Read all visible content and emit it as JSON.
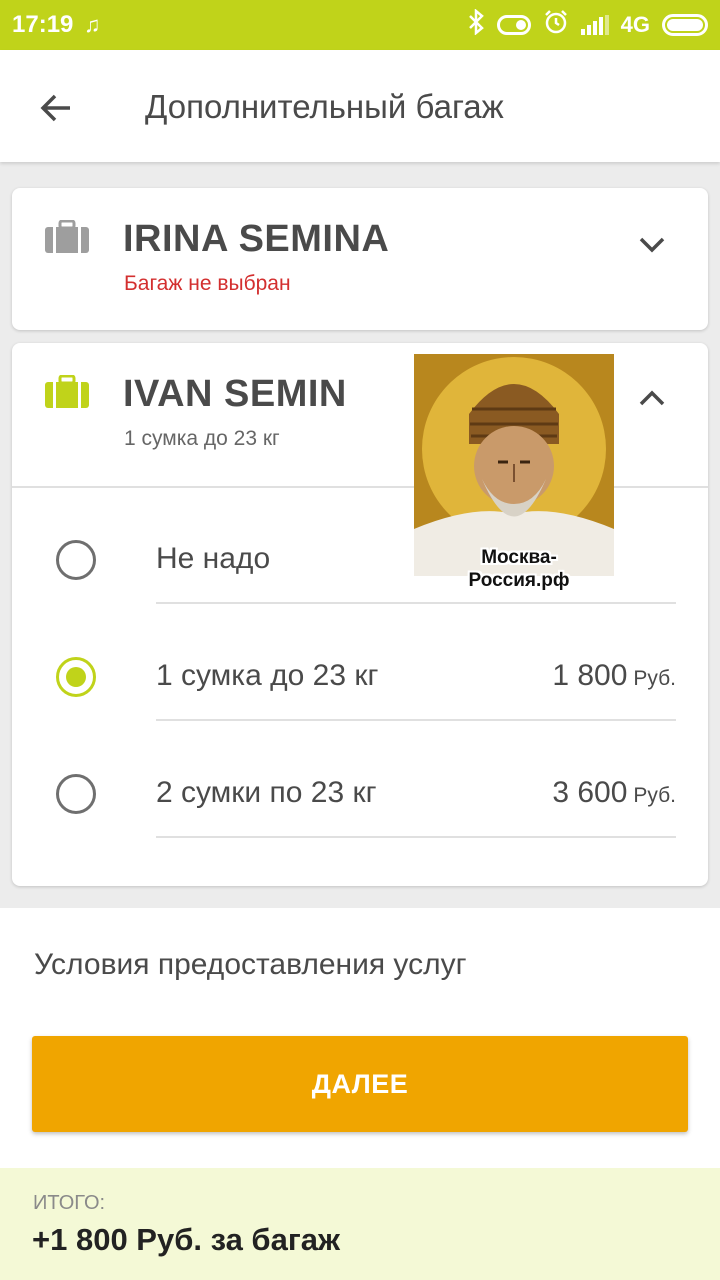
{
  "status_bar": {
    "time": "17:19",
    "network": "4G",
    "icons": [
      "music-app-icon",
      "bluetooth-icon",
      "toggle-icon",
      "alarm-icon",
      "signal-icon",
      "battery-icon"
    ]
  },
  "app_bar": {
    "title": "Дополнительный багаж",
    "back_icon": "arrow-left-icon"
  },
  "passengers": [
    {
      "name": "IRINA SEMINA",
      "status": "Багаж не выбран",
      "status_color": "#d32f2f",
      "bag_icon_color": "#9e9e9e",
      "expanded": false
    },
    {
      "name": "IVAN SEMIN",
      "status": "1 сумка до 23 кг",
      "status_color": "#666666",
      "bag_icon_color": "#c0d31a",
      "expanded": true,
      "options": [
        {
          "label": "Не надо",
          "price": "",
          "currency": "",
          "selected": false
        },
        {
          "label": "1 сумка до 23 кг",
          "price": "1 800",
          "currency": "Руб.",
          "selected": true
        },
        {
          "label": "2 сумки по 23 кг",
          "price": "3 600",
          "currency": "Руб.",
          "selected": false
        }
      ]
    }
  ],
  "overlay": {
    "caption_line1": "Москва-",
    "caption_line2": "Россия.рф"
  },
  "terms_link": "Условия предоставления услуг",
  "next_button": "ДАЛЕЕ",
  "footer": {
    "total_label": "ИТОГО:",
    "total_value": "+1 800 Руб. за багаж"
  },
  "colors": {
    "accent": "#c0d31a",
    "button": "#f0a500",
    "footer_bg": "#f4f9d6"
  }
}
